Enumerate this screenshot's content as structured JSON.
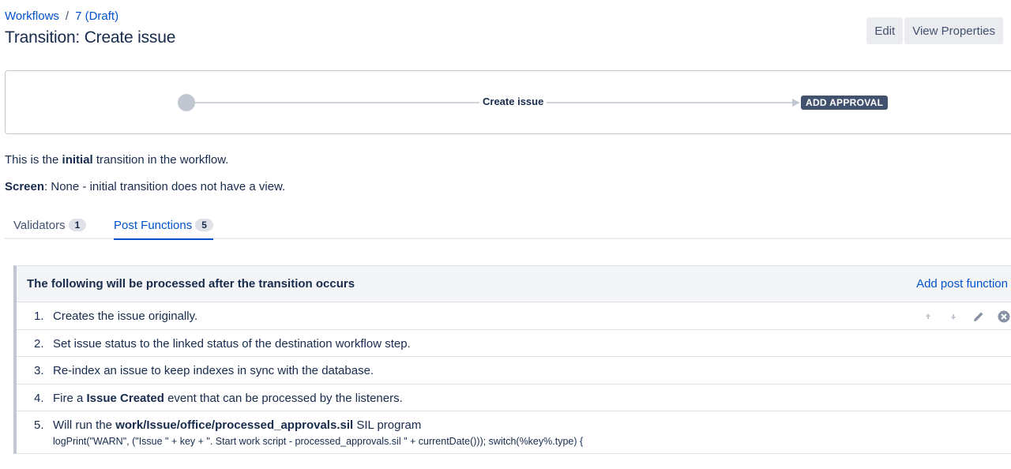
{
  "breadcrumb": {
    "workflows": "Workflows",
    "separator": "/",
    "draft": "7 (Draft)"
  },
  "page_title": "Transition: Create issue",
  "header_actions": {
    "edit": "Edit",
    "view_properties": "View Properties"
  },
  "diagram": {
    "transition_label": "Create issue",
    "target_status": "ADD APPROVAL"
  },
  "info": {
    "line1_pre": "This is the ",
    "line1_bold": "initial",
    "line1_post": " transition in the workflow.",
    "line2_bold": "Screen",
    "line2_post": ": None - initial transition does not have a view."
  },
  "tabs": [
    {
      "label": "Validators",
      "count": "1",
      "active": false
    },
    {
      "label": "Post Functions",
      "count": "5",
      "active": true
    }
  ],
  "panel": {
    "title": "The following will be processed after the transition occurs",
    "add_link": "Add post function",
    "rows": [
      {
        "num": "1.",
        "text": "Creates the issue originally."
      },
      {
        "num": "2.",
        "text": "Set issue status to the linked status of the destination workflow step."
      },
      {
        "num": "3.",
        "text": "Re-index an issue to keep indexes in sync with the database."
      },
      {
        "num": "4.",
        "pre": "Fire a ",
        "bold": "Issue Created",
        "post": " event that can be processed by the listeners."
      },
      {
        "num": "5.",
        "pre": "Will run the ",
        "bold": "work/Issue/office/processed_approvals.sil",
        "post": " SIL program",
        "code": "logPrint(\"WARN\", (\"Issue \" + key + \". Start work script - processed_approvals.sil \" + currentDate())); switch(%key%.type) {"
      }
    ]
  },
  "icons": {
    "move_up": "arrow-up-icon",
    "move_down": "arrow-down-icon",
    "edit": "pencil-icon",
    "delete": "close-circle-icon"
  },
  "colors": {
    "link": "#0052cc",
    "text": "#172b4d",
    "lozenge": "#42526e"
  }
}
